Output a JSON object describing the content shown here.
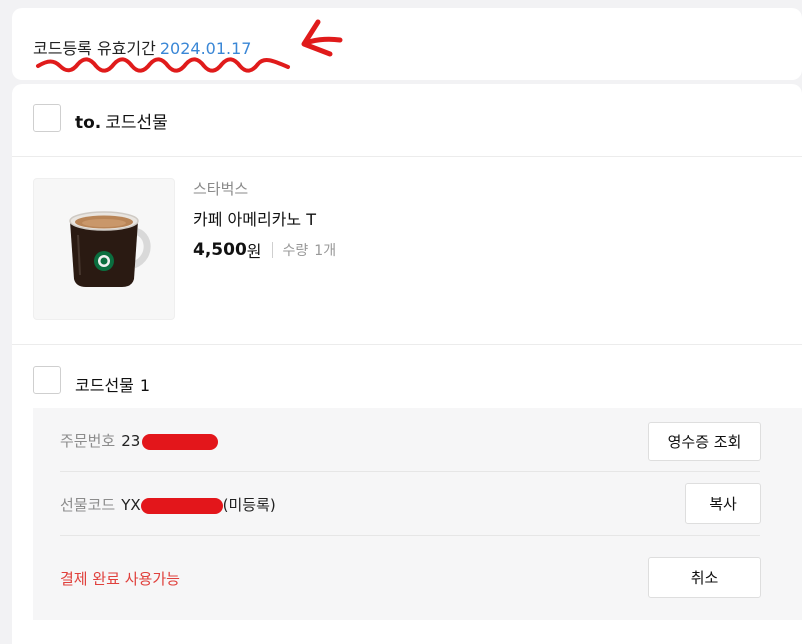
{
  "expiry": {
    "label": "코드등록 유효기간",
    "date": "2024.01.17"
  },
  "order_header": {
    "to": "to.",
    "title": "코드선물"
  },
  "product": {
    "brand": "스타벅스",
    "name": "카페 아메리카노 T",
    "price": "4,500",
    "currency": "원",
    "qty_label": "수량",
    "qty_value": "1개"
  },
  "gift": {
    "label": "코드선물",
    "number": "1"
  },
  "details": {
    "order_number_label": "주문번호",
    "order_number_prefix": "23",
    "receipt_button": "영수증 조회",
    "gift_code_label": "선물코드",
    "gift_code_prefix": "YX",
    "gift_code_suffix": "(미등록)",
    "copy_button": "복사",
    "status": "결제 완료 사용가능",
    "cancel_button": "취소"
  },
  "colors": {
    "accent_date": "#3a87d6",
    "status_red": "#e0403c",
    "redaction": "#e3161b",
    "annotation": "#e01b1b"
  },
  "icons": [
    "coffee-mug-icon"
  ]
}
